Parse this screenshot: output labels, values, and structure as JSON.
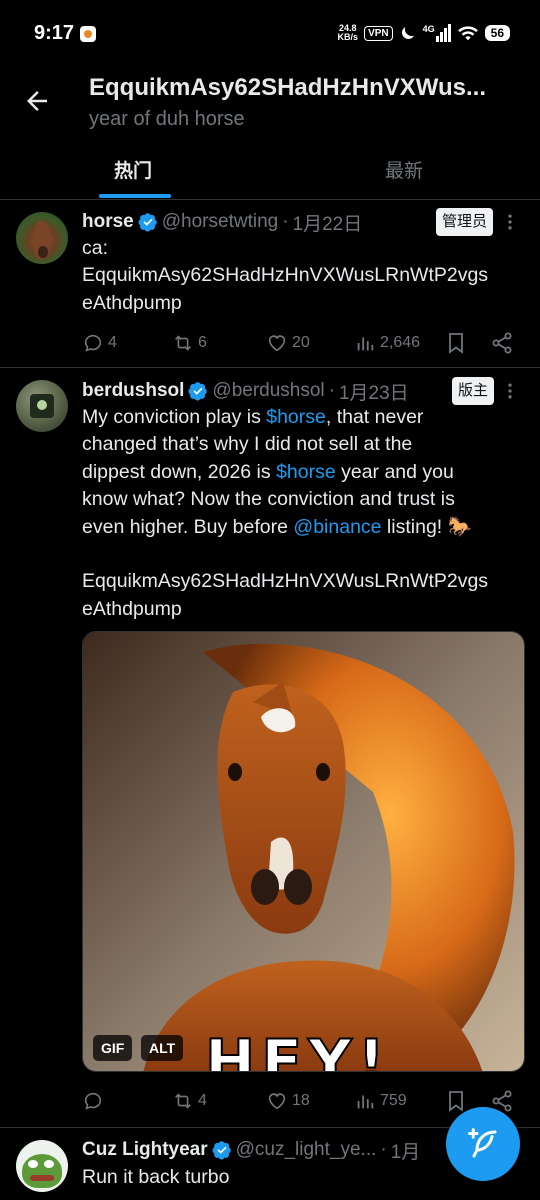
{
  "status_bar": {
    "time": "9:17",
    "speed_value": "24.8",
    "speed_unit": "KB/s",
    "vpn": "VPN",
    "network": "4G",
    "battery": "56"
  },
  "header": {
    "title": "EqquikmAsy62SHadHzHnVXWus...",
    "subtitle": "year of duh horse",
    "tabs": [
      {
        "label": "热门",
        "active": true
      },
      {
        "label": "最新",
        "active": false
      }
    ]
  },
  "tweets": [
    {
      "name": "horse",
      "handle": "@horsetwting",
      "sep": "·",
      "date": "1月22日",
      "badge": "管理员",
      "text_line1": "ca:",
      "text_line2": "EqquikmAsy62SHadHzHnVXWusLRnWtP2vgs",
      "text_line3": "eAthdpump",
      "replies": "4",
      "reposts": "6",
      "likes": "20",
      "views": "2,646"
    },
    {
      "name": "berdushsol",
      "handle": "@berdushsol",
      "sep": "·",
      "date": "1月23日",
      "badge": "版主",
      "text_a": "My conviction play is ",
      "link_horse": "$horse",
      "text_b": ", that never",
      "line2": "changed that’s why I did not sell at the",
      "line3_a": "dippest down, 2026 is ",
      "line3_b": " year and you",
      "line4": "know what? Now the conviction and trust is",
      "line5_a": "even higher. Buy before ",
      "link_binance": "@binance",
      "line5_b": " listing! 🐎",
      "ca_line1": "EqquikmAsy62SHadHzHnVXWusLRnWtP2vgs",
      "ca_line2": "eAthdpump",
      "media_tag_gif": "GIF",
      "media_tag_alt": "ALT",
      "media_caption": "HEY!",
      "replies": "",
      "reposts": "4",
      "likes": "18",
      "views": "759"
    },
    {
      "name": "Cuz Lightyear",
      "handle": "@cuz_light_ye...",
      "sep": "·",
      "date": "1月",
      "text": "Run it back turbo"
    }
  ],
  "colors": {
    "accent": "#1d9bf0",
    "background": "#000000",
    "muted": "#71767b"
  }
}
